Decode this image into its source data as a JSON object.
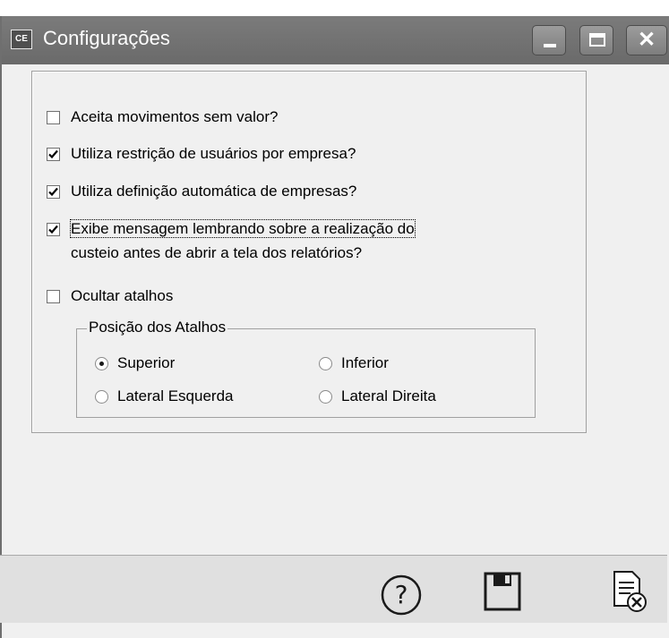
{
  "window": {
    "title": "Configurações",
    "app_icon_text": "CE"
  },
  "options": [
    {
      "id": "aceita",
      "label": "Aceita movimentos sem valor?",
      "checked": false
    },
    {
      "id": "restricao",
      "label": "Utiliza restrição de usuários por empresa?",
      "checked": true
    },
    {
      "id": "definicao",
      "label": "Utiliza definição automática de empresas?",
      "checked": true
    },
    {
      "id": "mensagem",
      "label_line1": "Exibe mensagem lembrando sobre a realização do",
      "label_line2": "custeio antes de abrir a tela dos relatórios?",
      "checked": true
    },
    {
      "id": "ocultar",
      "label": "Ocultar atalhos",
      "checked": false
    }
  ],
  "positions_group": {
    "title": "Posição dos Atalhos",
    "options": [
      {
        "label": "Superior",
        "selected": true
      },
      {
        "label": "Inferior",
        "selected": false
      },
      {
        "label": "Lateral Esquerda",
        "selected": false
      },
      {
        "label": "Lateral Direita",
        "selected": false
      }
    ]
  },
  "toolbar": {
    "icons": [
      "help-icon",
      "save-icon",
      "cancel-document-icon"
    ]
  }
}
